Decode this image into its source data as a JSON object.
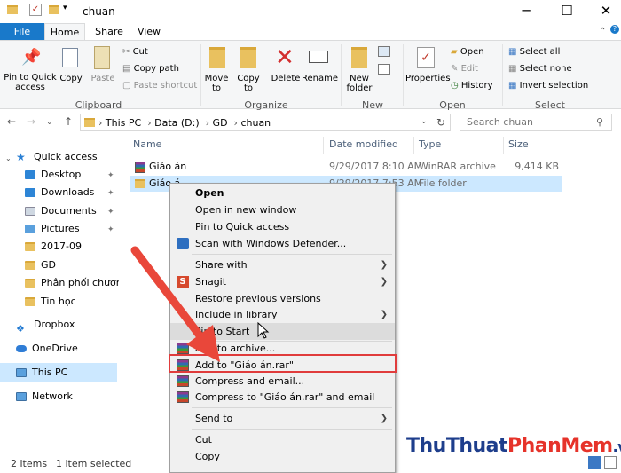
{
  "window": {
    "title": "chuan",
    "minimize": "─",
    "maximize": "☐",
    "close": "✕"
  },
  "tabs": [
    {
      "label": "File"
    },
    {
      "label": "Home"
    },
    {
      "label": "Share"
    },
    {
      "label": "View"
    }
  ],
  "ribbon": {
    "clipboard": {
      "pin": "Pin to Quick access",
      "copy": "Copy",
      "paste": "Paste",
      "cut": "Cut",
      "copy_path": "Copy path",
      "paste_shortcut": "Paste shortcut",
      "group": "Clipboard"
    },
    "organize": {
      "move_to": "Move to",
      "copy_to": "Copy to",
      "delete": "Delete",
      "rename": "Rename",
      "group": "Organize"
    },
    "new": {
      "new_folder": "New folder",
      "group": "New"
    },
    "open": {
      "properties": "Properties",
      "open": "Open",
      "edit": "Edit",
      "history": "History",
      "group": "Open"
    },
    "select": {
      "select_all": "Select all",
      "select_none": "Select none",
      "invert": "Invert selection",
      "group": "Select"
    }
  },
  "address": {
    "crumbs": [
      "This PC",
      "Data (D:)",
      "GD",
      "chuan"
    ],
    "search_placeholder": "Search chuan"
  },
  "nav_pane": [
    {
      "label": "Quick access"
    },
    {
      "label": "Desktop"
    },
    {
      "label": "Downloads"
    },
    {
      "label": "Documents"
    },
    {
      "label": "Pictures"
    },
    {
      "label": "2017-09"
    },
    {
      "label": "GD"
    },
    {
      "label": "Phân phối chương t"
    },
    {
      "label": "Tin học"
    },
    {
      "label": "Dropbox"
    },
    {
      "label": "OneDrive"
    },
    {
      "label": "This PC"
    },
    {
      "label": "Network"
    }
  ],
  "columns": {
    "name": "Name",
    "date": "Date modified",
    "type": "Type",
    "size": "Size"
  },
  "files": [
    {
      "name": "Giáo án",
      "date": "9/29/2017 8:10 AM",
      "type": "WinRAR archive",
      "size": "9,414 KB"
    },
    {
      "name": "Giáo á",
      "date": "9/29/2017 7:53 AM",
      "type": "File folder",
      "size": ""
    }
  ],
  "context_menu": [
    {
      "label": "Open"
    },
    {
      "label": "Open in new window"
    },
    {
      "label": "Pin to Quick access"
    },
    {
      "label": "Scan with Windows Defender..."
    },
    {
      "label": "Share with"
    },
    {
      "label": "Snagit"
    },
    {
      "label": "Restore previous versions"
    },
    {
      "label": "Include in library"
    },
    {
      "label": "Pin to Start"
    },
    {
      "label": "Add to archive..."
    },
    {
      "label": "Add to \"Giáo án.rar\""
    },
    {
      "label": "Compress and email..."
    },
    {
      "label": "Compress to \"Giáo án.rar\" and email"
    },
    {
      "label": "Send to"
    },
    {
      "label": "Cut"
    },
    {
      "label": "Copy"
    }
  ],
  "status": {
    "items": "2 items",
    "selected": "1 item selected"
  },
  "watermark": {
    "part1": "ThuThuat",
    "part2": "PhanMem",
    "part3": ".vn"
  },
  "colors": {
    "accent": "#1979ca",
    "selection": "#cce8ff",
    "highlight_box": "#e03c3c",
    "arrow": "#e9473a"
  }
}
